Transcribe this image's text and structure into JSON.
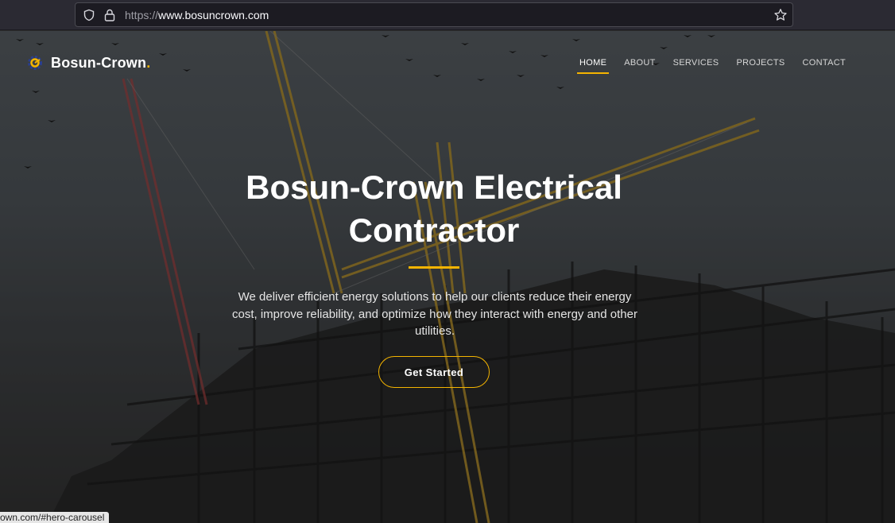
{
  "browser": {
    "url_scheme": "https://",
    "url_host": "www.bosuncrown.com"
  },
  "header": {
    "brand": "Bosun-Crown",
    "brand_dot": ".",
    "nav": [
      {
        "label": "HOME"
      },
      {
        "label": "ABOUT"
      },
      {
        "label": "SERVICES"
      },
      {
        "label": "PROJECTS"
      },
      {
        "label": "CONTACT"
      }
    ]
  },
  "hero": {
    "title": "Bosun-Crown Electrical Contractor",
    "description": "We deliver efficient energy solutions to help our clients reduce their energy cost, improve reliability, and optimize how they interact with energy and other utilities.",
    "cta_label": "Get Started"
  },
  "status_bar": {
    "link": "own.com/#hero-carousel"
  },
  "colors": {
    "accent": "#f4b400",
    "text": "#ffffff"
  }
}
